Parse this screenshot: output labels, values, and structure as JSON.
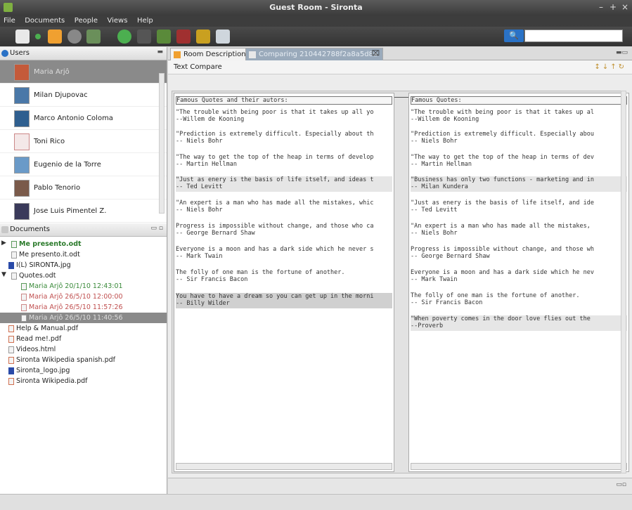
{
  "window": {
    "title": "Guest Room - Sironta"
  },
  "menu": [
    "File",
    "Documents",
    "People",
    "Views",
    "Help"
  ],
  "search": {
    "value": ""
  },
  "users_panel": {
    "title": "Users",
    "users": [
      "Maria Arjô",
      "Milan Djupovac",
      "Marco Antonio Coloma",
      "Toni Rico",
      "Eugenio de la Torre",
      "Pablo Tenorio",
      "Jose Luis Pimentel Z."
    ]
  },
  "documents_panel": {
    "title": "Documents",
    "items": [
      "Me presento.odt",
      "Me presento.it.odt",
      "I(L) SIRONTA.jpg",
      "Quotes.odt",
      "Maria Arjô 20/1/10 12:43:01",
      "Maria Arjô 26/5/10 12:00:00",
      "Maria Arjô 26/5/10 11:57:26",
      "Maria Arjô 26/5/10 11:40:56",
      "Help & Manual.pdf",
      "Read me!.pdf",
      "Videos.html",
      "Sironta Wikipedia spanish.pdf",
      "Sironta_logo.jpg",
      "Sironta Wikipedia.pdf"
    ]
  },
  "tabs": [
    "Room Description",
    "Comparing 210442788f2a8a5d8a"
  ],
  "compare": {
    "title": "Text Compare",
    "left": [
      "Famous Quotes and their autors:",
      "\"The trouble with being poor is that it takes up all yo\n--Willem de Kooning",
      "\"Prediction is extremely difficult. Especially about th\n-- Niels Bohr",
      "\"The way to get the top of the heap in terms of develop\n-- Martin Hellman",
      "\"Just as enery is the basis of life itself, and ideas t\n-- Ted Levitt",
      "\"An expert is a man who has made all the mistakes, whic\n-- Niels Bohr",
      "Progress is impossible without change, and those who ca\n-- George Bernard Shaw",
      "Everyone is a moon and has a dark side which he never s\n-- Mark Twain",
      "The folly of one man is the fortune of another.\n-- Sir Francis Bacon",
      "You have to have a dream so you can get up in the morni\n-- Billy Wilder"
    ],
    "right": [
      "Famous Quotes:",
      "\"The trouble with being poor is that it takes up al\n--Willem de Kooning",
      "\"Prediction is extremely difficult. Especially abou\n-- Niels Bohr",
      "\"The way to get the top of the heap in terms of dev\n-- Martin Hellman",
      "\"Business has only two functions - marketing and in\n-- Milan Kundera",
      "\"Just as enery is the basis of life itself, and ide\n-- Ted Levitt",
      "\"An expert is a man who has made all the mistakes, \n-- Niels Bohr",
      "Progress is impossible without change, and those wh\n-- George Bernard Shaw",
      "Everyone is a moon and has a dark side which he nev\n-- Mark Twain",
      "The folly of one man is the fortune of another.\n-- Sir Francis Bacon",
      "\"When poverty comes in the door love flies out the \n--Proverb"
    ]
  },
  "colors": {
    "selection": "#8a8a8a",
    "accent": "#2a72c6",
    "titlebar": "#3b3b3b"
  }
}
